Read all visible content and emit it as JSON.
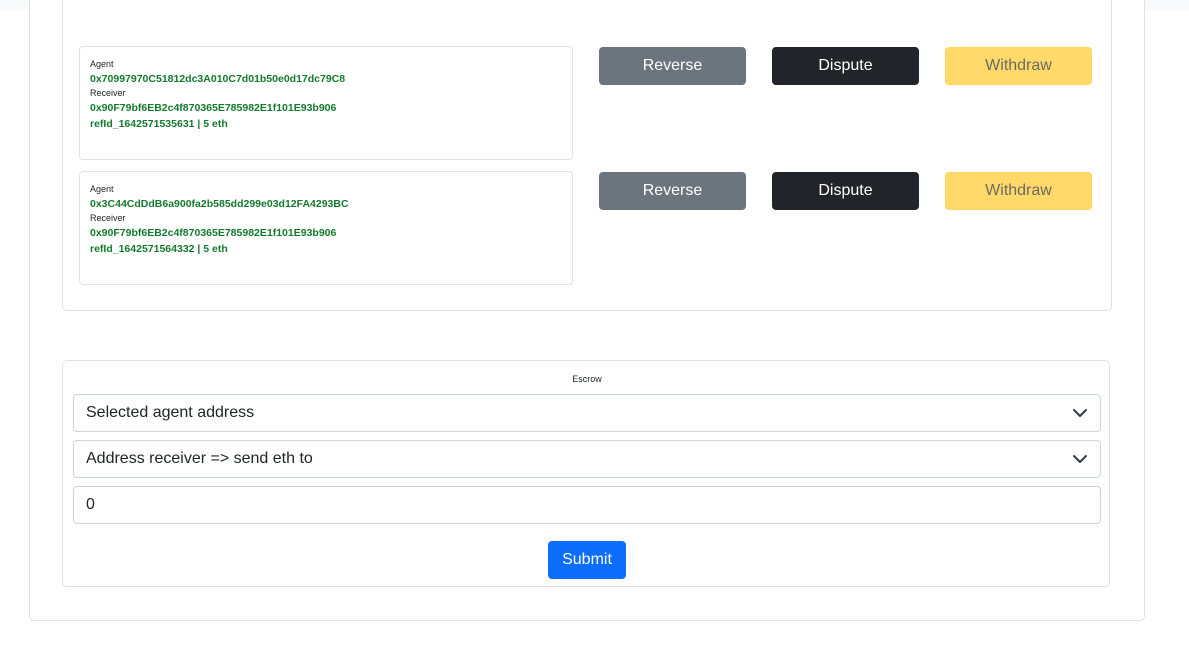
{
  "transactions": [
    {
      "agent_label": "Agent",
      "agent_address": "0x70997970C51812dc3A010C7d01b50e0d17dc79C8",
      "receiver_label": "Receiver",
      "receiver_address": "0x90F79bf6EB2c4f870365E785982E1f101E93b906",
      "ref_line": "refId_1642571535631 | 5 eth",
      "actions": {
        "reverse": "Reverse",
        "dispute": "Dispute",
        "withdraw": "Withdraw"
      }
    },
    {
      "agent_label": "Agent",
      "agent_address": "0x3C44CdDdB6a900fa2b585dd299e03d12FA4293BC",
      "receiver_label": "Receiver",
      "receiver_address": "0x90F79bf6EB2c4f870365E785982E1f101E93b906",
      "ref_line": "refId_1642571564332 | 5 eth",
      "actions": {
        "reverse": "Reverse",
        "dispute": "Dispute",
        "withdraw": "Withdraw"
      }
    }
  ],
  "escrow": {
    "title": "Escrow",
    "agent_select": "Selected agent address",
    "receiver_select": "Address receiver => send eth to",
    "amount_value": "0",
    "submit_label": "Submit"
  },
  "icons": {
    "select_chevron": "chevron-down-icon"
  },
  "colors": {
    "address_green": "#157a2e",
    "reverse_bg": "#6c757d",
    "dispute_bg": "#212529",
    "withdraw_bg": "#ffda6a",
    "submit_bg": "#0d6efd",
    "border": "#dee2e6"
  }
}
